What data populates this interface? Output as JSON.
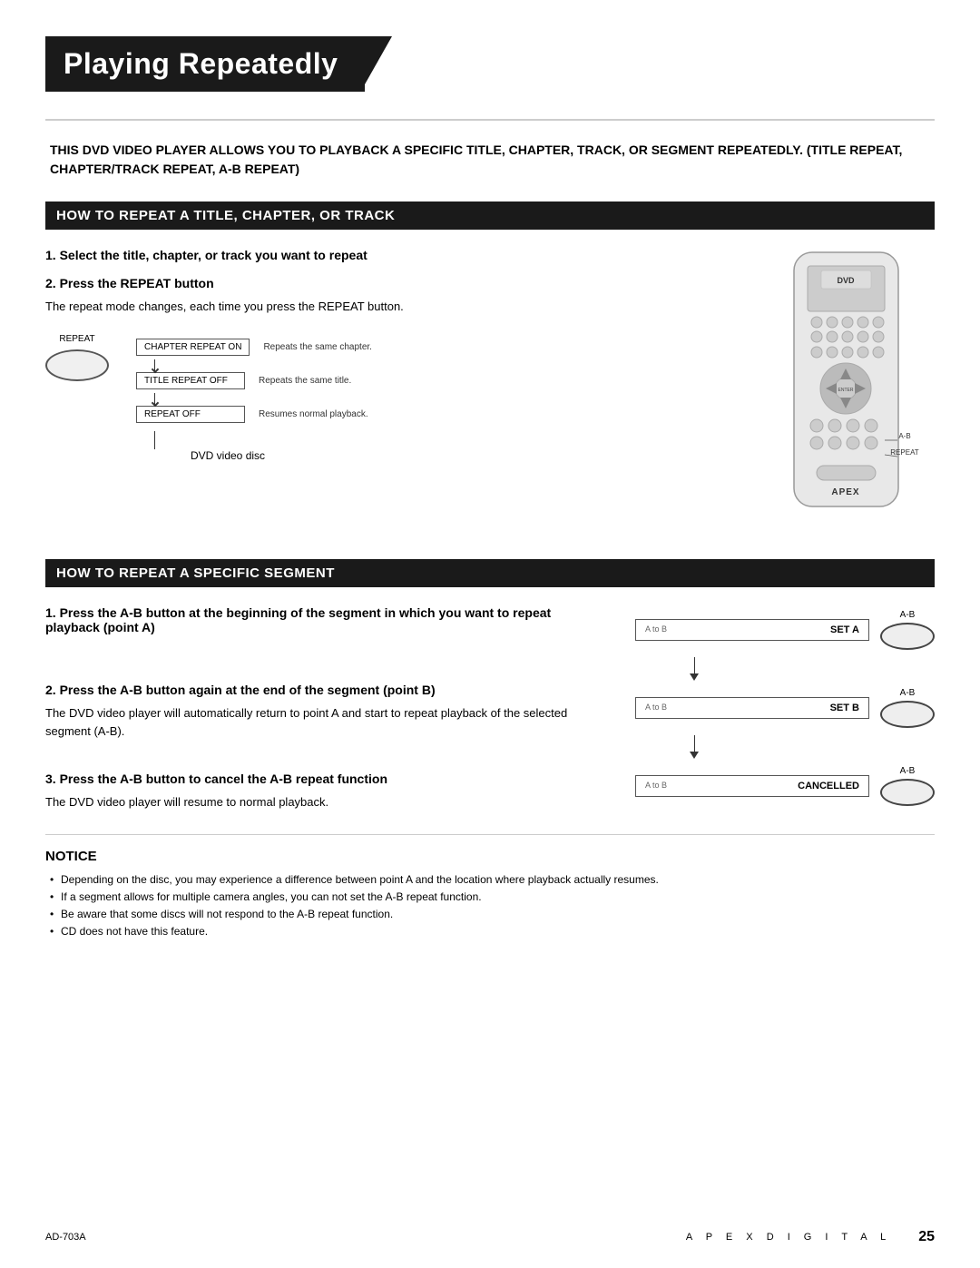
{
  "title": "Playing Repeatedly",
  "intro": "THIS DVD VIDEO PLAYER ALLOWS YOU TO PLAYBACK A SPECIFIC TITLE, CHAPTER, TRACK, OR SEGMENT REPEATEDLY. (TITLE REPEAT, CHAPTER/TRACK REPEAT, A-B REPEAT)",
  "section1": {
    "header": "HOW TO REPEAT A TITLE, CHAPTER, OR TRACK",
    "step1_title": "1. Select the title, chapter, or track you want to repeat",
    "step2_title": "2. Press the REPEAT button",
    "step2_body": "The repeat mode changes, each time you press the REPEAT button.",
    "repeat_label": "REPEAT",
    "flow_items": [
      {
        "label": "CHAPTER REPEAT ON",
        "description": "Repeats the same chapter."
      },
      {
        "label": "TITLE REPEAT OFF",
        "description": "Repeats the same title."
      },
      {
        "label": "REPEAT OFF",
        "description": "Resumes normal playback."
      }
    ],
    "dvd_label": "DVD video disc",
    "ab_label": "A-B",
    "repeat_side_label": "REPEAT"
  },
  "section2": {
    "header": "HOW TO REPEAT A SPECIFIC SEGMENT",
    "step1_title": "1. Press the A-B button at the beginning of the segment in which you want to repeat playback (point A)",
    "step2_title": "2. Press the A-B button again at the end of the segment (point B)",
    "step2_body": "The DVD video player will automatically return to point A and start to repeat playback of the selected segment (A-B).",
    "step3_title": "3. Press the A-B button to cancel the A-B repeat function",
    "step3_body": "The DVD video player will resume to normal playback.",
    "seg1_label_left": "A to B",
    "seg1_value": "SET A",
    "seg2_label_left": "A to B",
    "seg2_value": "SET B",
    "seg3_label_left": "A to B",
    "seg3_value": "CANCELLED",
    "ab_label1": "A-B",
    "ab_label2": "A-B",
    "ab_label3": "A-B"
  },
  "notice": {
    "title": "NOTICE",
    "items": [
      "Depending on the disc, you may experience a difference between point A and the location where playback actually resumes.",
      "If a segment allows for multiple camera angles, you can not set the A-B repeat function.",
      "Be aware that some discs will not respond to the A-B repeat function.",
      "CD does not have this feature."
    ]
  },
  "footer": {
    "model": "AD-703A",
    "brand": "A  P  E  X     D  I  G  I  T  A  L",
    "page": "25"
  }
}
